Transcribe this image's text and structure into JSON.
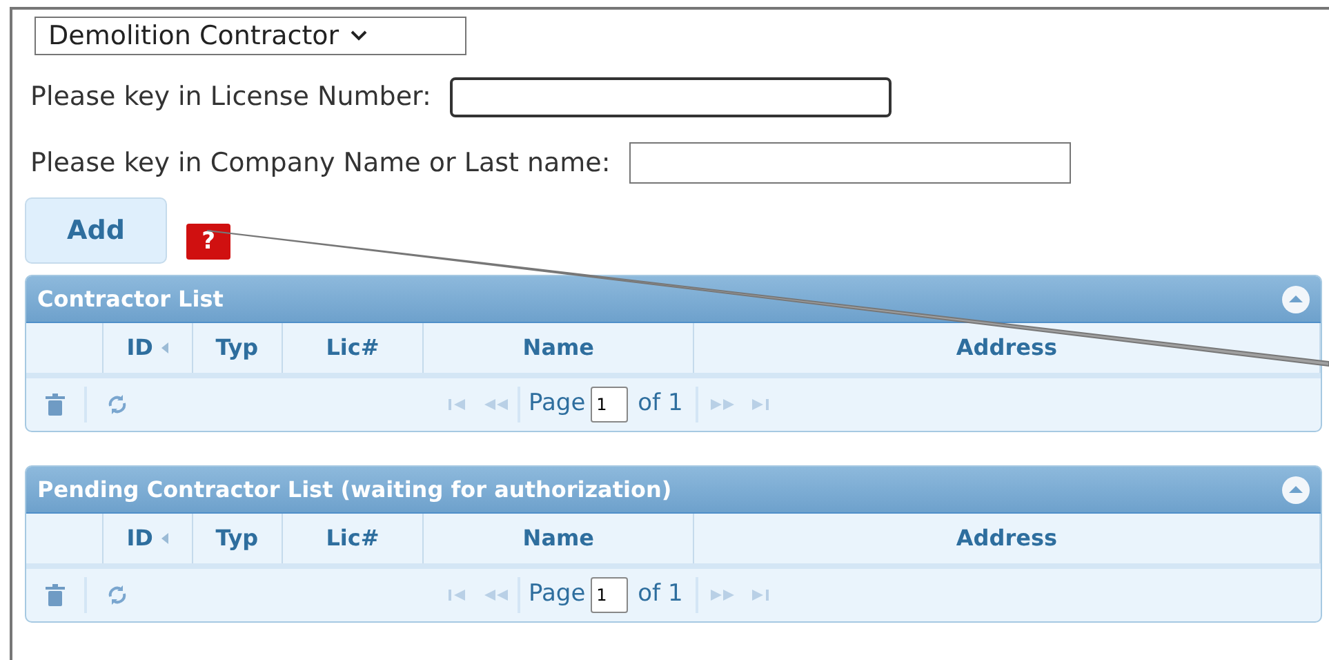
{
  "contractor_type": {
    "value": "Demolition Contractor"
  },
  "license_field": {
    "label": "Please key in License Number:"
  },
  "company_field": {
    "label": "Please key in Company Name or Last name:"
  },
  "add_button": {
    "label": "Add"
  },
  "help_button": {
    "label": "?"
  },
  "grids": [
    {
      "title": "Contractor List",
      "columns": [
        "ID",
        "Typ",
        "Lic#",
        "Name",
        "Address"
      ],
      "pager": {
        "page_label": "Page",
        "page": "1",
        "of_label": "of 1"
      }
    },
    {
      "title": "Pending Contractor List (waiting for authorization)",
      "columns": [
        "ID",
        "Typ",
        "Lic#",
        "Name",
        "Address"
      ],
      "pager": {
        "page_label": "Page",
        "page": "1",
        "of_label": "of 1"
      }
    }
  ]
}
